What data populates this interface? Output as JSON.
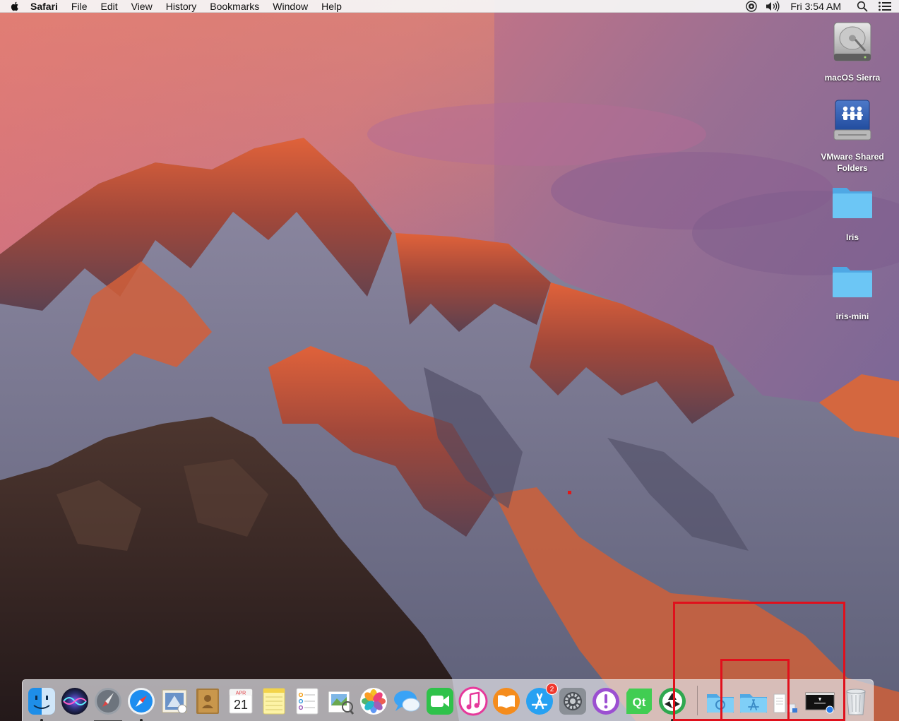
{
  "menubar": {
    "app_name": "Safari",
    "menus": [
      "File",
      "Edit",
      "View",
      "History",
      "Bookmarks",
      "Window",
      "Help"
    ],
    "clock": "Fri 3:54 AM",
    "status_icons": [
      "screen-recording-icon",
      "volume-icon",
      "spotlight-search-icon",
      "notification-center-icon"
    ]
  },
  "desktop": {
    "icons": [
      {
        "label": "macOS Sierra",
        "icon": "hard-drive-icon"
      },
      {
        "label": "VMware Shared Folders",
        "icon": "network-drive-icon"
      },
      {
        "label": "Iris",
        "icon": "folder-icon"
      },
      {
        "label": "iris-mini",
        "icon": "folder-icon"
      }
    ]
  },
  "dock": {
    "apps": [
      {
        "name": "Finder",
        "icon": "finder-icon",
        "running": true
      },
      {
        "name": "Siri",
        "icon": "siri-icon",
        "running": false
      },
      {
        "name": "Launchpad",
        "icon": "launchpad-icon",
        "running": false
      },
      {
        "name": "Safari",
        "icon": "safari-icon",
        "running": true
      },
      {
        "name": "Mail",
        "icon": "mail-icon",
        "running": false
      },
      {
        "name": "Contacts",
        "icon": "contacts-icon",
        "running": false
      },
      {
        "name": "Calendar",
        "icon": "calendar-icon",
        "running": false,
        "month": "APR",
        "day": "21"
      },
      {
        "name": "Notes",
        "icon": "notes-icon",
        "running": false
      },
      {
        "name": "Reminders",
        "icon": "reminders-icon",
        "running": false
      },
      {
        "name": "Preview",
        "icon": "preview-icon",
        "running": false
      },
      {
        "name": "Photos",
        "icon": "photos-icon",
        "running": false
      },
      {
        "name": "Messages",
        "icon": "messages-icon",
        "running": false
      },
      {
        "name": "FaceTime",
        "icon": "facetime-icon",
        "running": false
      },
      {
        "name": "iTunes",
        "icon": "itunes-icon",
        "running": false
      },
      {
        "name": "iBooks",
        "icon": "ibooks-icon",
        "running": false
      },
      {
        "name": "App Store",
        "icon": "app-store-icon",
        "running": false,
        "badge": "2"
      },
      {
        "name": "System Preferences",
        "icon": "system-preferences-icon",
        "running": false
      },
      {
        "name": "Feedback Assistant",
        "icon": "feedback-assistant-icon",
        "running": false
      },
      {
        "name": "Qt Creator",
        "icon": "qt-creator-icon",
        "running": false,
        "label": "Qt"
      },
      {
        "name": "Screenshot App",
        "icon": "aperture-icon",
        "running": true
      }
    ],
    "right_items": [
      {
        "name": "Downloads",
        "icon": "downloads-stack-icon"
      },
      {
        "name": "Applications",
        "icon": "applications-folder-icon"
      },
      {
        "name": "Documents",
        "icon": "documents-stack-icon"
      },
      {
        "name": "Screenshot",
        "icon": "screenshot-stack-icon"
      },
      {
        "name": "Trash",
        "icon": "trash-icon"
      }
    ]
  },
  "colors": {
    "annotation_red": "#e0101c",
    "folder_blue": "#6cc6f5"
  }
}
